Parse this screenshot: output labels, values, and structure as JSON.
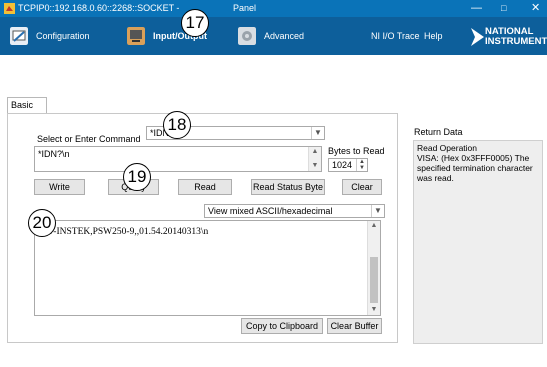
{
  "title_bar": {
    "text": "TCPIP0::192.168.0.60::2268::SOCKET - ",
    "text_tail": "Panel",
    "min_glyph": "—",
    "max_glyph": "□",
    "close_glyph": "✕"
  },
  "toolbar": {
    "configuration": "Configuration",
    "input_output": "Input/Output",
    "advanced": "Advanced",
    "ni_io_trace": "NI I/O Trace",
    "help": "Help",
    "logo_line1": "NATIONAL",
    "logo_line2": "INSTRUMENTS"
  },
  "tab": {
    "label": "Basic I/O"
  },
  "command": {
    "label": "Select or Enter Command",
    "selected": "*IDN?\\n",
    "textarea_value": "*IDN?\\n"
  },
  "bytes_to_read": {
    "label": "Bytes to Read",
    "value": "1024"
  },
  "buttons": {
    "write": "Write",
    "query": "Query",
    "read": "Read",
    "read_status_byte": "Read Status Byte",
    "clear": "Clear",
    "copy_to_clipboard": "Copy to Clipboard",
    "clear_buffer": "Clear Buffer"
  },
  "view_mode": {
    "selected": "View mixed ASCII/hexadecimal"
  },
  "output": {
    "text": "GW-INSTEK,PSW250-9,,01.54.20140313\\n"
  },
  "return_data": {
    "label": "Return Data",
    "line1": "Read Operation",
    "line2": "VISA:  (Hex 0x3FFF0005) The specified termination character was read."
  },
  "callouts": {
    "c17": "17",
    "c18": "18",
    "c19": "19",
    "c20": "20"
  },
  "colors": {
    "titlebar": "#0a73b8",
    "toolbar": "#0d5f9b",
    "input_output_icon": "#d9a05a"
  }
}
